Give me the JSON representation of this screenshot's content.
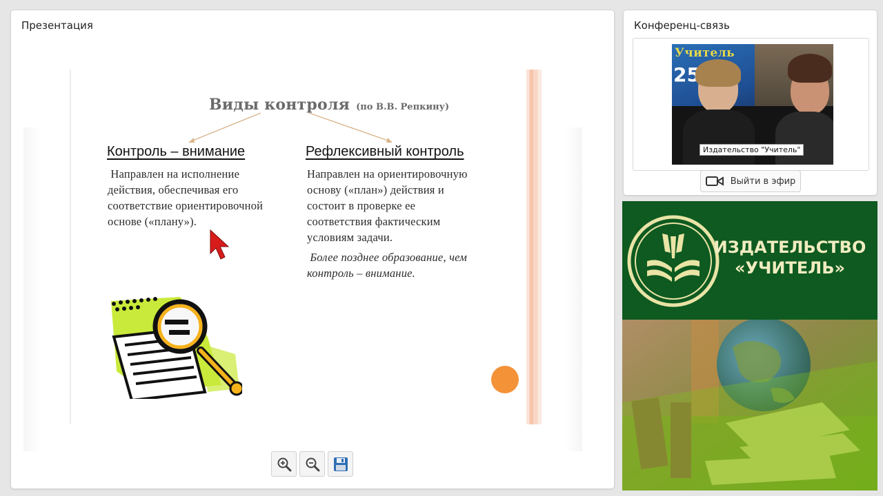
{
  "presentation": {
    "panel_title": "Презентация",
    "slide": {
      "title_main": "Виды контроля",
      "title_sub": "(по В.В. Репкину)",
      "left": {
        "heading": "Контроль – внимание",
        "lines": [
          " Направлен на исполнение",
          "действия, обеспечивая его",
          "соответствие ориентировочной",
          "основе («плану»)."
        ]
      },
      "right": {
        "heading": "Рефлексивный контроль",
        "lines": [
          "Направлен на ориентировочную",
          "основу («план») действия и",
          "состоит в проверке ее",
          "соответствия фактическим",
          "условиям задачи."
        ],
        "italic_lines": [
          " Более позднее образование, чем",
          "контроль – внимание."
        ]
      }
    },
    "toolbar": {
      "zoom_in_icon": "zoom-in-icon",
      "zoom_out_icon": "zoom-out-icon",
      "save_icon": "save-icon"
    }
  },
  "conference": {
    "panel_title": "Конференц-связь",
    "video_banner_text": "Учитель",
    "video_banner_number": "25",
    "video_caption": "Издательство \"Учитель\"",
    "onair_button_label": "Выйти в эфир"
  },
  "ad": {
    "publisher_line1": "ИЗДАТЕЛЬСТВО",
    "publisher_line2": "«УЧИТЕЛЬ»"
  },
  "colors": {
    "ad_green": "#0e5a21",
    "slide_accent_orange": "#f39237",
    "slide_title_gray": "#6a6a6a"
  }
}
